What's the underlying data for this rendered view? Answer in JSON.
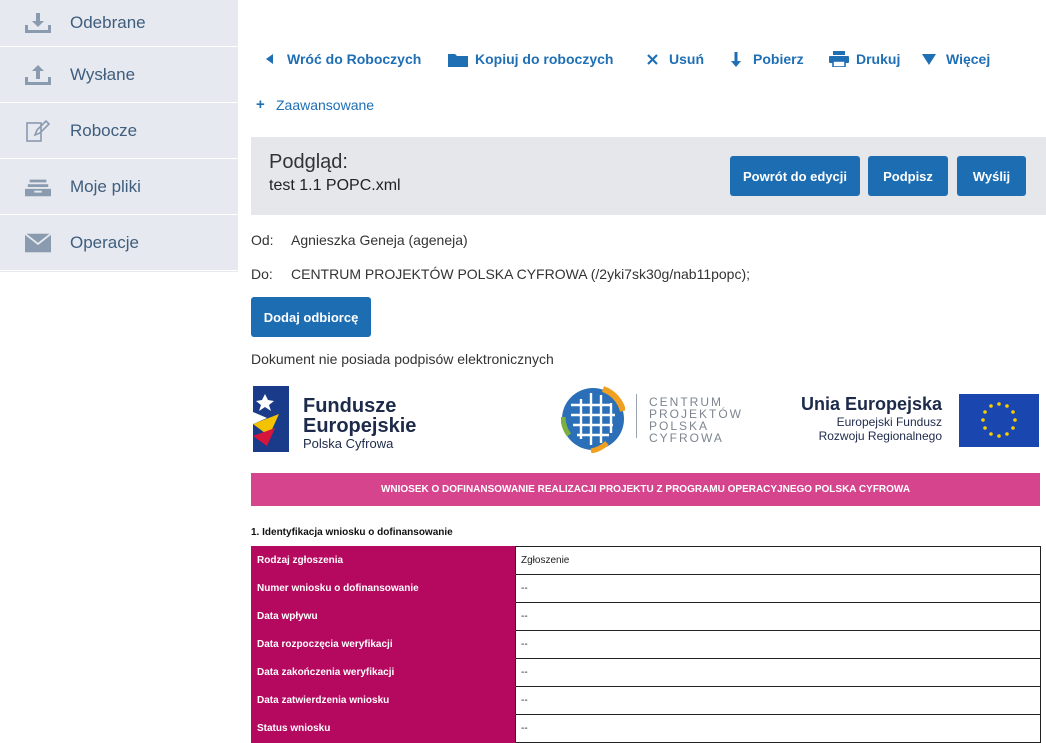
{
  "sidebar": {
    "items": [
      {
        "label": "Odebrane",
        "icon": "download-tray-icon"
      },
      {
        "label": "Wysłane",
        "icon": "upload-tray-icon"
      },
      {
        "label": "Robocze",
        "icon": "draft-edit-icon"
      },
      {
        "label": "Moje pliki",
        "icon": "files-stack-icon"
      },
      {
        "label": "Operacje",
        "icon": "envelope-icon"
      }
    ]
  },
  "toolbar": {
    "back_label": "Wróć do Roboczych",
    "copy_label": "Kopiuj do roboczych",
    "delete_label": "Usuń",
    "download_label": "Pobierz",
    "print_label": "Drukuj",
    "more_label": "Więcej",
    "advanced_label": "Zaawansowane"
  },
  "preview": {
    "title": "Podgląd:",
    "filename": "test 1.1 POPC.xml",
    "btn_back_edit": "Powrót do edycji",
    "btn_sign": "Podpisz",
    "btn_send": "Wyślij"
  },
  "meta": {
    "from_label": "Od:",
    "from_value": "Agnieszka Geneja (ageneja)",
    "to_label": "Do:",
    "to_value": "CENTRUM PROJEKTÓW POLSKA CYFROWA (/2yki7sk30g/nab11popc);",
    "add_recipient": "Dodaj odbiorcę",
    "signature_status": "Dokument nie posiada podpisów elektronicznych"
  },
  "logos": {
    "fe_line1": "Fundusze",
    "fe_line2": "Europejskie",
    "fe_line3": "Polska Cyfrowa",
    "cpc_line1": "CENTRUM",
    "cpc_line2": "PROJEKTÓW",
    "cpc_line3": "POLSKA",
    "cpc_line4": "CYFROWA",
    "ue_title": "Unia Europejska",
    "ue_line1": "Europejski Fundusz",
    "ue_line2": "Rozwoju Regionalnego"
  },
  "document": {
    "banner": "WNIOSEK O DOFINANSOWANIE REALIZACJI PROJEKTU Z PROGRAMU OPERACYJNEGO POLSKA CYFROWA",
    "section1_title": "1. Identyfikacja wniosku o dofinansowanie",
    "rows": [
      {
        "label": "Rodzaj zgłoszenia",
        "value": "Zgłoszenie"
      },
      {
        "label": "Numer wniosku o dofinansowanie",
        "value": "--"
      },
      {
        "label": "Data wpływu",
        "value": "--"
      },
      {
        "label": "Data rozpoczęcia weryfikacji",
        "value": "--"
      },
      {
        "label": "Data zakończenia weryfikacji",
        "value": "--"
      },
      {
        "label": "Data zatwierdzenia wniosku",
        "value": "--"
      },
      {
        "label": "Status wniosku",
        "value": "--"
      }
    ]
  },
  "colors": {
    "accent": "#1d6db3",
    "banner": "#d6448e",
    "table_header": "#b5095f",
    "sidebar_bg": "#e6e9ef"
  }
}
